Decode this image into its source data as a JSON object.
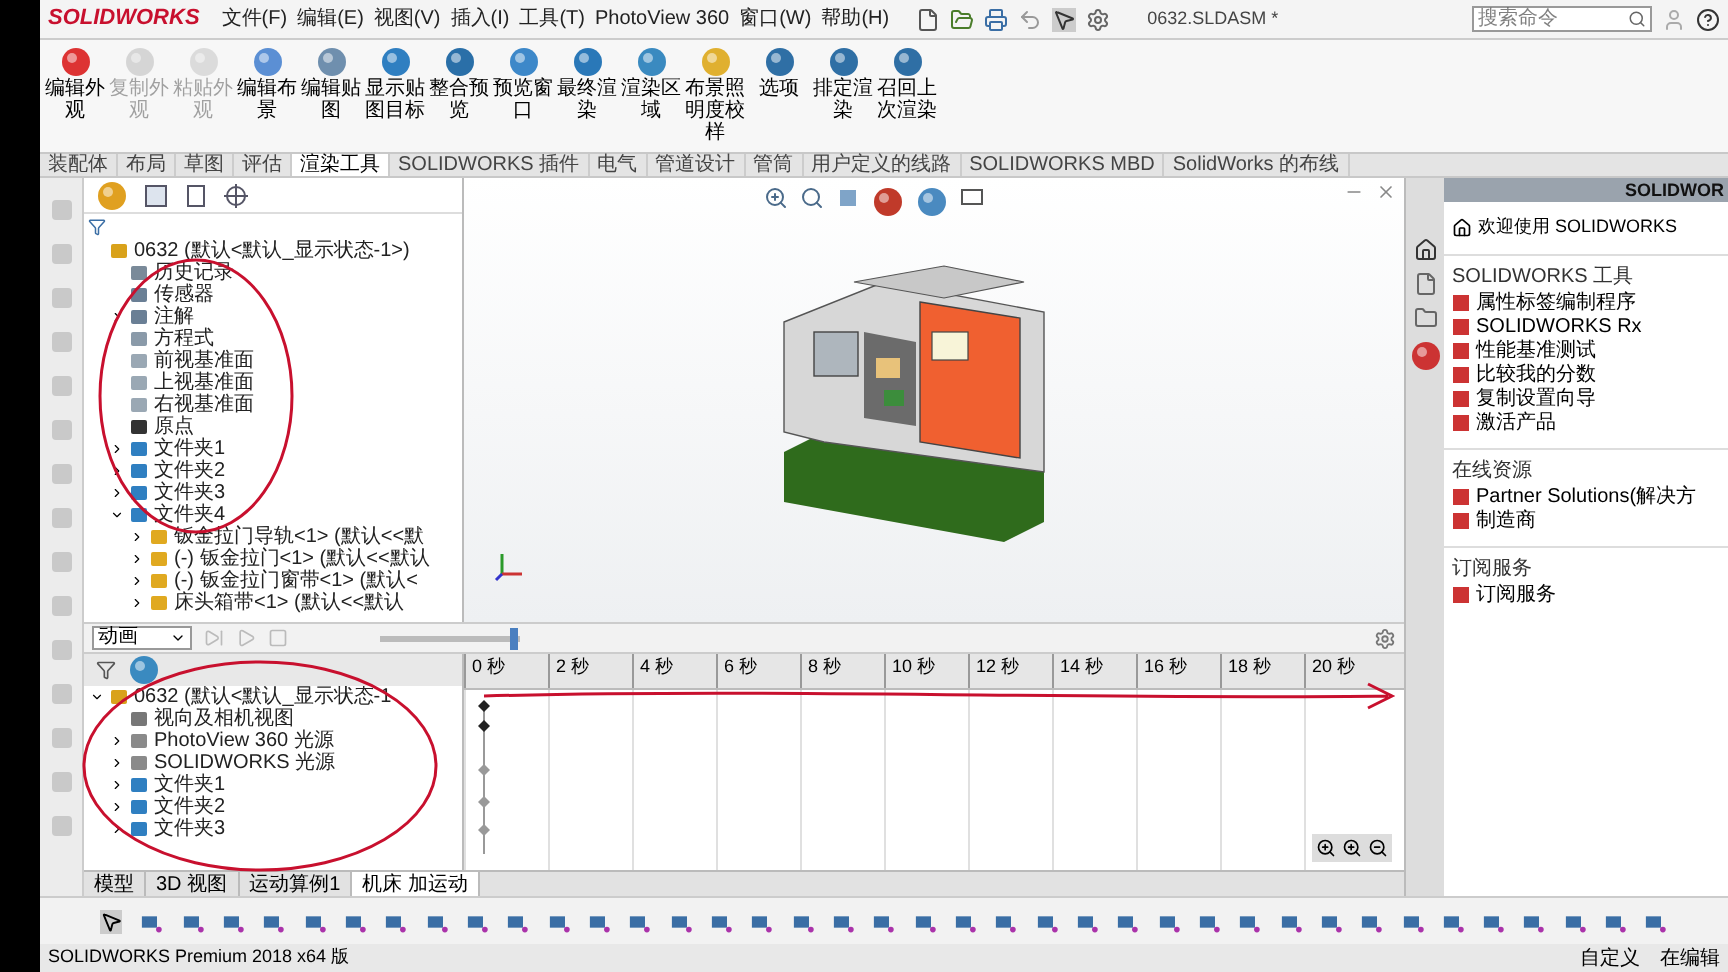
{
  "menu": {
    "logo": "SOLIDWORKS",
    "items": [
      "文件(F)",
      "编辑(E)",
      "视图(V)",
      "插入(I)",
      "工具(T)",
      "PhotoView 360",
      "窗口(W)",
      "帮助(H)"
    ]
  },
  "title": "0632.SLDASM *",
  "search": {
    "placeholder": "搜索命令"
  },
  "ribbon": [
    {
      "label": "编辑外观",
      "disabled": false
    },
    {
      "label": "复制外观",
      "disabled": true
    },
    {
      "label": "粘贴外观",
      "disabled": true
    },
    {
      "label": "编辑布景",
      "disabled": false
    },
    {
      "label": "编辑贴图",
      "disabled": false
    },
    {
      "label": "显示贴图目标",
      "disabled": false
    },
    {
      "label": "整合预览",
      "disabled": false
    },
    {
      "label": "预览窗口",
      "disabled": false
    },
    {
      "label": "最终渲染",
      "disabled": false
    },
    {
      "label": "渲染区域",
      "disabled": false
    },
    {
      "label": "布景照明度校样",
      "disabled": false
    },
    {
      "label": "选项",
      "disabled": false
    },
    {
      "label": "排定渲染",
      "disabled": false
    },
    {
      "label": "召回上次渲染",
      "disabled": false
    }
  ],
  "tabs": [
    {
      "label": "装配体",
      "selected": false
    },
    {
      "label": "布局",
      "selected": false
    },
    {
      "label": "草图",
      "selected": false
    },
    {
      "label": "评估",
      "selected": false
    },
    {
      "label": "渲染工具",
      "selected": true
    },
    {
      "label": "SOLIDWORKS 插件",
      "selected": false
    },
    {
      "label": "电气",
      "selected": false
    },
    {
      "label": "管道设计",
      "selected": false
    },
    {
      "label": "管筒",
      "selected": false
    },
    {
      "label": "用户定义的线路",
      "selected": false
    },
    {
      "label": "SOLIDWORKS MBD",
      "selected": false
    },
    {
      "label": "SolidWorks 的布线",
      "selected": false
    }
  ],
  "feature_tree": [
    {
      "label": "0632 (默认<默认_显示状态-1>)",
      "kind": "assembly",
      "children": [
        {
          "label": "历史记录",
          "kind": "history"
        },
        {
          "label": "传感器",
          "kind": "sensor"
        },
        {
          "label": "注解",
          "kind": "annotation",
          "expanded": false
        },
        {
          "label": "方程式",
          "kind": "equation"
        },
        {
          "label": "前视基准面",
          "kind": "plane"
        },
        {
          "label": "上视基准面",
          "kind": "plane"
        },
        {
          "label": "右视基准面",
          "kind": "plane"
        },
        {
          "label": "原点",
          "kind": "origin"
        },
        {
          "label": "文件夹1",
          "kind": "folder",
          "expanded": false
        },
        {
          "label": "文件夹2",
          "kind": "folder",
          "expanded": false
        },
        {
          "label": "文件夹3",
          "kind": "folder",
          "expanded": false
        },
        {
          "label": "文件夹4",
          "kind": "folder",
          "expanded": true,
          "children": [
            {
              "label": "钣金拉门导轨<1> (默认<<默",
              "kind": "part",
              "expanded": false
            },
            {
              "label": "(-) 钣金拉门<1> (默认<<默认",
              "kind": "part",
              "expanded": false
            },
            {
              "label": "(-) 钣金拉门窗带<1> (默认<",
              "kind": "part",
              "expanded": false
            },
            {
              "label": "床头箱带<1> (默认<<默认",
              "kind": "part",
              "expanded": false
            }
          ]
        }
      ]
    }
  ],
  "task_pane": {
    "header": "SOLIDWOR",
    "welcome": "欢迎使用 SOLIDWORKS",
    "sections": [
      {
        "title": "SOLIDWORKS 工具",
        "items": [
          "属性标签编制程序",
          "SOLIDWORKS Rx",
          "性能基准测试",
          "比较我的分数",
          "复制设置向导",
          "激活产品"
        ]
      },
      {
        "title": "在线资源",
        "items": [
          "Partner Solutions(解决方",
          "制造商"
        ]
      },
      {
        "title": "订阅服务",
        "items": [
          "订阅服务"
        ]
      }
    ]
  },
  "motion": {
    "study_type": "动画",
    "speed_slider": {
      "level": 0.95
    },
    "ticks": [
      "0 秒",
      "2 秒",
      "4 秒",
      "6 秒",
      "8 秒",
      "10 秒",
      "12 秒",
      "14 秒",
      "16 秒",
      "18 秒",
      "20 秒"
    ],
    "tree": [
      {
        "label": "0632 (默认<默认_显示状态-1",
        "kind": "assembly",
        "expanded": true,
        "children": [
          {
            "label": "视向及相机视图",
            "kind": "camera"
          },
          {
            "label": "PhotoView 360 光源",
            "kind": "light",
            "expanded": false
          },
          {
            "label": "SOLIDWORKS 光源",
            "kind": "light",
            "expanded": false
          },
          {
            "label": "文件夹1",
            "kind": "folder",
            "expanded": false
          },
          {
            "label": "文件夹2",
            "kind": "folder",
            "expanded": false
          },
          {
            "label": "文件夹3",
            "kind": "folder",
            "expanded": false
          }
        ]
      }
    ]
  },
  "bottom_tabs": [
    {
      "label": "模型",
      "selected": false
    },
    {
      "label": "3D 视图",
      "selected": false
    },
    {
      "label": "运动算例1",
      "selected": false
    },
    {
      "label": "机床 加运动",
      "selected": true
    }
  ],
  "status": {
    "product": "SOLIDWORKS Premium 2018 x64 版",
    "items": [
      "自定义",
      "在编辑"
    ]
  }
}
